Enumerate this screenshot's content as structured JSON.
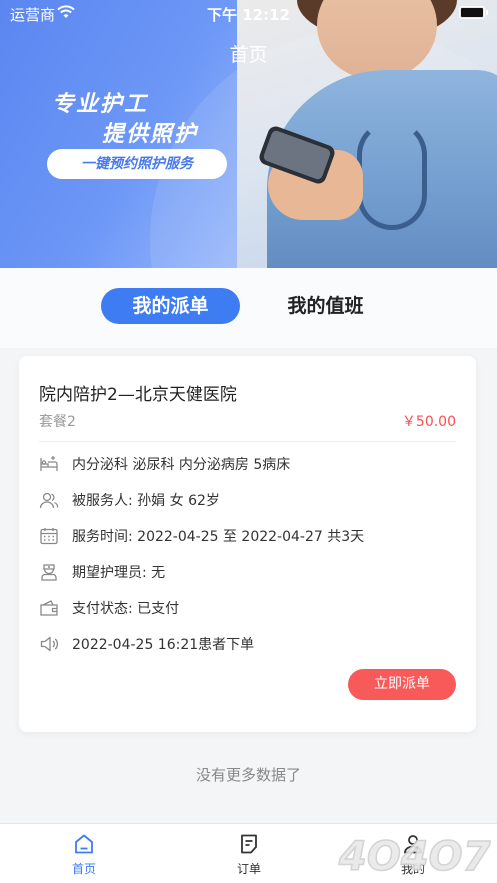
{
  "status_bar": {
    "carrier": "运营商",
    "time": "下午 12:12"
  },
  "header": {
    "title": "首页"
  },
  "banner": {
    "line1": "专业护工",
    "line2": "提供照护",
    "button": "一键预约照护服务"
  },
  "tabs": [
    {
      "label": "我的派单",
      "active": true
    },
    {
      "label": "我的值班",
      "active": false
    }
  ],
  "order": {
    "title": "院内陪护2—北京天健医院",
    "package": "套餐2",
    "price": "￥50.00",
    "rows": [
      {
        "icon": "bed-icon",
        "text": "内分泌科  泌尿科  内分泌病房  5病床"
      },
      {
        "icon": "user-icon",
        "text": "被服务人:  孙娟   女   62岁"
      },
      {
        "icon": "calendar-icon",
        "text": "服务时间:  2022-04-25   至   2022-04-27   共3天"
      },
      {
        "icon": "nurse-icon",
        "text": "期望护理员:  无"
      },
      {
        "icon": "wallet-icon",
        "text": "支付状态:  已支付"
      },
      {
        "icon": "speaker-icon",
        "text": "2022-04-25 16:21患者下单"
      }
    ],
    "action": "立即派单"
  },
  "footer_note": "没有更多数据了",
  "tabbar": [
    {
      "label": "首页",
      "icon": "home-icon",
      "active": true
    },
    {
      "label": "订单",
      "icon": "order-icon",
      "active": false
    },
    {
      "label": "我的",
      "icon": "profile-icon",
      "active": false
    }
  ],
  "colors": {
    "primary": "#3d7cf2",
    "danger": "#f85a5a",
    "price": "#ff4d4f"
  }
}
